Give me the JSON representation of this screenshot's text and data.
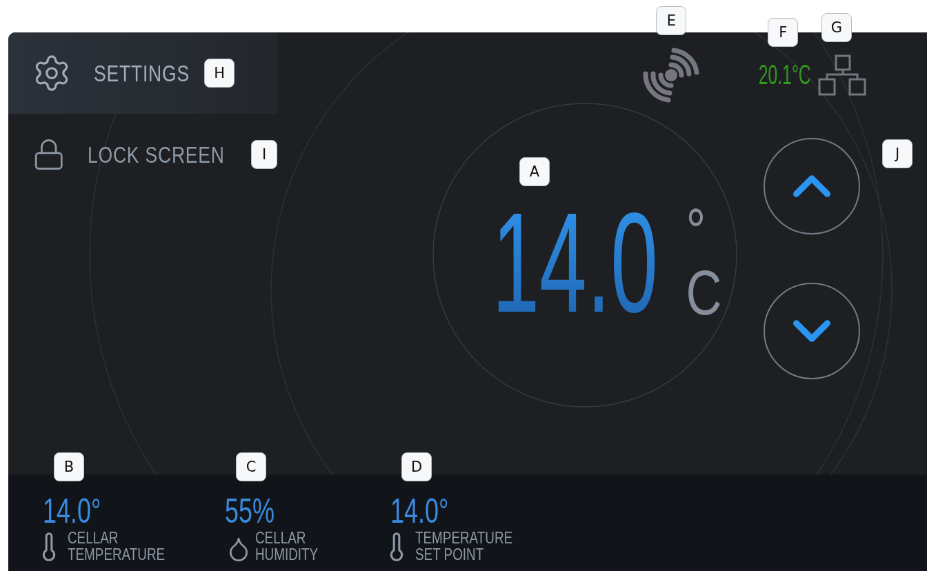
{
  "menu": [
    {
      "kind": "gear",
      "label": "SETTINGS",
      "selected": true,
      "callout": "H"
    },
    {
      "kind": "lock",
      "label": "LOCK SCREEN",
      "selected": false,
      "callout": "I"
    }
  ],
  "status": [
    {
      "kind": "signal",
      "callout": "E"
    },
    {
      "kind": "temperature",
      "text": "20.1°C",
      "callout": "F"
    },
    {
      "kind": "network",
      "callout": "G"
    }
  ],
  "setpoint": {
    "value": "14.0",
    "degree": "°",
    "unit": "C",
    "callout": "A"
  },
  "controls": {
    "callout": "J",
    "buttons": [
      {
        "kind": "up"
      },
      {
        "kind": "down"
      }
    ]
  },
  "readings": [
    {
      "kind": "thermometer",
      "value": "14.0°",
      "label": [
        "CELLAR",
        "TEMPERATURE"
      ],
      "callout": "B"
    },
    {
      "kind": "droplet",
      "value": "55%",
      "label": [
        "CELLAR",
        "HUMIDITY"
      ],
      "callout": "C"
    },
    {
      "kind": "thermometer",
      "value": "14.0°",
      "label": [
        "TEMPERATURE",
        "SET POINT"
      ],
      "callout": "D"
    }
  ]
}
